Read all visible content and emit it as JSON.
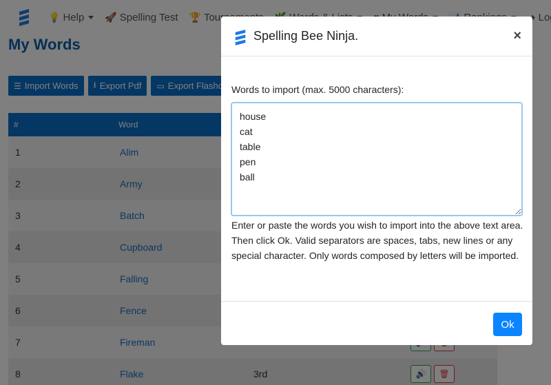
{
  "navbar": {
    "items": [
      {
        "label": "Help",
        "icon": "lightbulb-icon",
        "glyph": "💡",
        "dropdown": true
      },
      {
        "label": "Spelling Test",
        "icon": "rocket-icon",
        "glyph": "🚀",
        "dropdown": false
      },
      {
        "label": "Tournaments",
        "icon": "trophy-icon",
        "glyph": "🏆",
        "dropdown": false
      },
      {
        "label": "Words & Lists",
        "icon": "leaf-icon",
        "glyph": "🌿",
        "dropdown": true
      },
      {
        "label": "My Words",
        "icon": "heart-icon",
        "glyph": "♥",
        "dropdown": true
      },
      {
        "label": "Rankings",
        "icon": "chart-icon",
        "glyph": "📊",
        "dropdown": true
      },
      {
        "label": "Login",
        "icon": "login-icon",
        "glyph": "➜",
        "dropdown": false
      }
    ]
  },
  "page": {
    "title": "My Words"
  },
  "toolbar": {
    "import_label": "Import Words",
    "export_pdf_label": "Export Pdf",
    "export_flash_label": "Export Flashcards"
  },
  "table": {
    "headers": {
      "num": "#",
      "word": "Word"
    },
    "rows": [
      {
        "num": "1",
        "word": "Alim",
        "extra": ""
      },
      {
        "num": "2",
        "word": "Army",
        "extra": ""
      },
      {
        "num": "3",
        "word": "Batch",
        "extra": ""
      },
      {
        "num": "4",
        "word": "Cupboard",
        "extra": ""
      },
      {
        "num": "5",
        "word": "Falling",
        "extra": ""
      },
      {
        "num": "6",
        "word": "Fence",
        "extra": ""
      },
      {
        "num": "7",
        "word": "Fireman",
        "extra": ""
      },
      {
        "num": "8",
        "word": "Flake",
        "extra": "3rd"
      }
    ]
  },
  "modal": {
    "title": "Spelling Bee Ninja.",
    "close_label": "×",
    "field_label": "Words to import (max. 5000 characters):",
    "textarea_value": "house\ncat\ntable\npen\nball",
    "help_text": "Enter or paste the words you wish to import into the above text area. Then click Ok. Valid separators are spaces, tabs, new lines or any special character. Only words composed by letters will be imported.",
    "ok_label": "Ok"
  },
  "colors": {
    "primary": "#0b6fc9",
    "brand": "#0d5ea8",
    "ok": "#0b84ff",
    "sound": "#28a745",
    "trash": "#dc3545"
  }
}
